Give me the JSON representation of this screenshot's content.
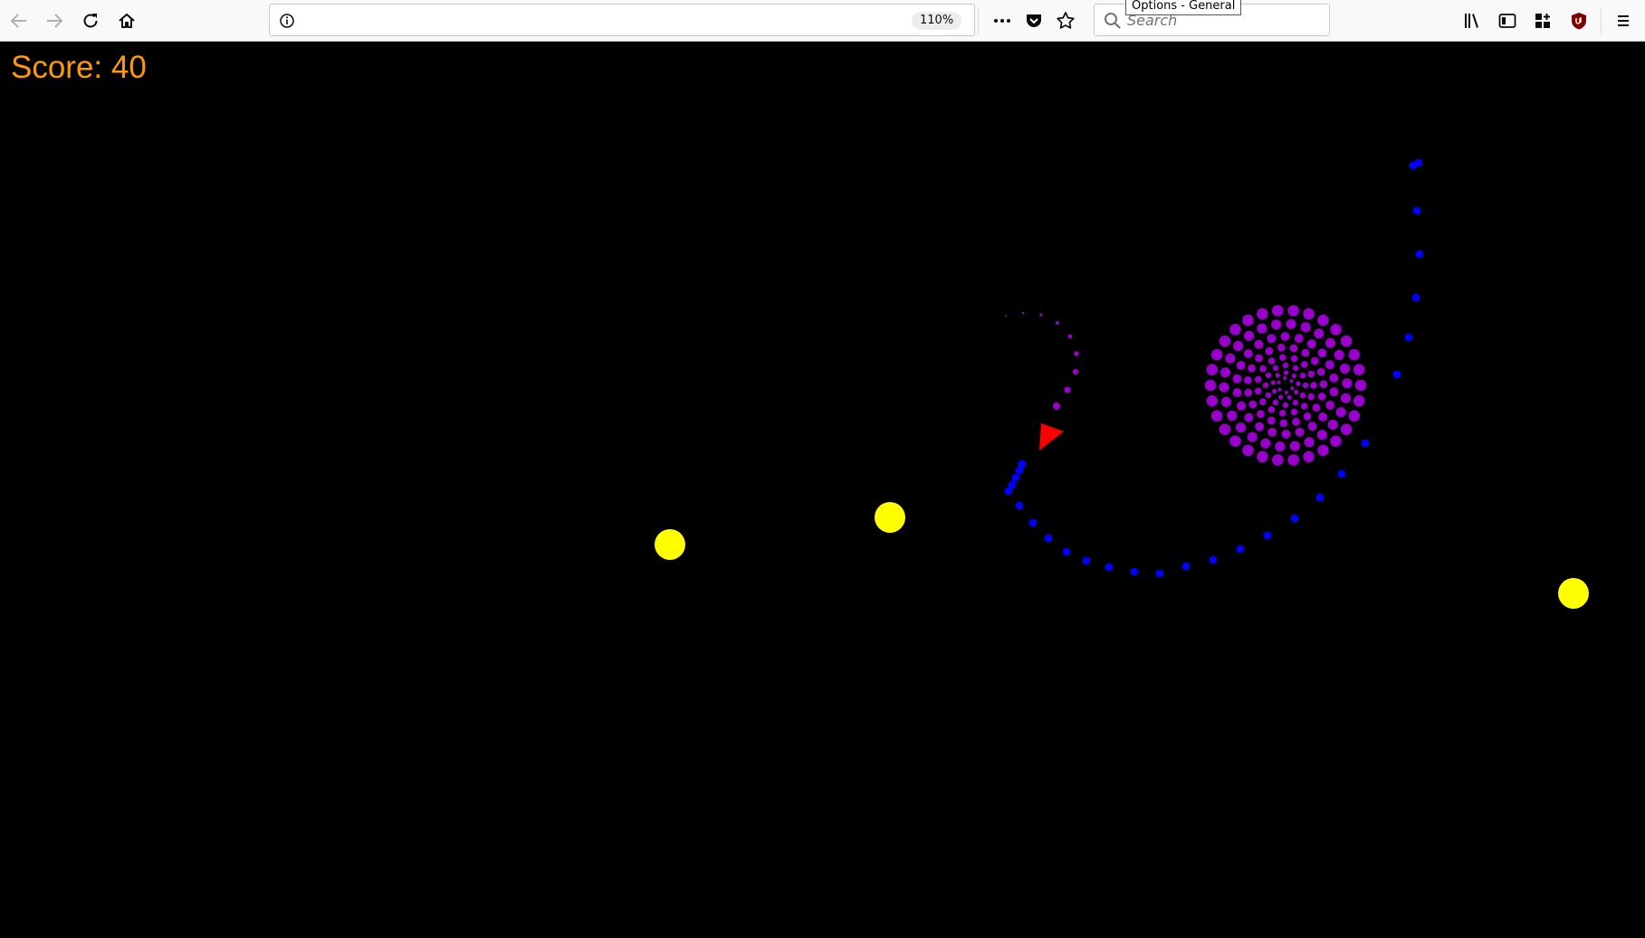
{
  "browser": {
    "zoom_level": "110%",
    "tooltip": "Options - General",
    "search_placeholder": "Search"
  },
  "game": {
    "score_label": "Score: 40",
    "score": 40,
    "colors": {
      "background": "#000000",
      "score_text": "#ff9a00",
      "player": "#ff0000",
      "pellet": "#ffff00",
      "blue_dots": "#0000ff",
      "purple_dots": "#9900cc"
    }
  }
}
